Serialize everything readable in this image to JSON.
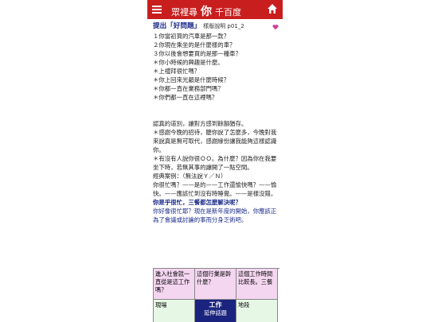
{
  "header": {
    "brand_left": "眾裡尋",
    "brand_big": "你",
    "brand_right": "千百度"
  },
  "section": {
    "title": "提出「好問題」",
    "subtitle": "樣版說明 p01_2"
  },
  "questions": [
    "１你當初買的汽車是那一款？",
    "２你現在乘坐的是什麼樣的車？",
    "３你以後會想要買的是那一種車？",
    "＊你小時候的興趣是什麼。",
    "＊上禮拜很忙嗎？",
    "＊你上回來光顧是什麼時候？",
    "＊你都一直在業務部門嗎？",
    "＊你們都一直在這裡嗎？"
  ],
  "paragraphs": [
    "認真的道別，讓對方感到餘韻猶存。",
    "＊感謝今晚的招待，聽你說了怎麼多，今晚對我來說真是無可取代，感謝緣份讓我能夠這樣認識你。",
    "＊有沒有人說你很ＯＯ。為什麼？因為你在我要坐下時，若無其事的讓開了一點空間。",
    "經典案例：（無法說Ｙ／Ｎ）",
    "你很忙嗎？——是的——工作還愉快嗎？——愉快。——應該忙到沒有時睡覺。——是樣沒錯。"
  ],
  "highlight_question": "你是乎很忙，三餐都怎麼解決呢？",
  "highlight_text": "你好像很忙耶？現在是新年度的開始，你應該正為了會議或討論的事而分身乏術吧。",
  "grid": {
    "row1": [
      "進入社會就一直從是這工作嗎？",
      "這個行業是幹什麼？",
      "這個工作時間比較長。三餐"
    ],
    "row2_left": "現場",
    "row2_center_title": "工作",
    "row2_center_sub": "延伸話題",
    "row2_right": "地段"
  },
  "colors": {
    "topbar": "#c81e1e",
    "title_blue": "#1a2a8a",
    "grid_pink": "#f4d6f0",
    "grid_green": "#e6f7e6",
    "grid_center": "#1a237e"
  },
  "icons": {
    "menu": "hamburger-icon",
    "home": "home-icon",
    "favorite": "heart-icon"
  }
}
